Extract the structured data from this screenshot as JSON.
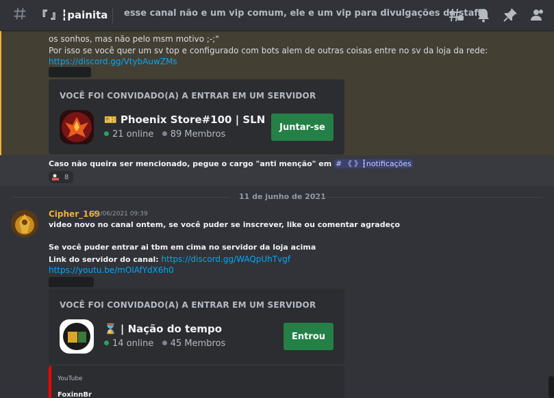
{
  "header": {
    "channel_name": "『 』┇painita",
    "topic": "esse canal não e um vip comum, ele e um vip para divulgações da staff",
    "icons": [
      "threads-icon",
      "bell-icon",
      "pin-icon",
      "members-icon"
    ]
  },
  "message1": {
    "line_partial": "os sonhos, mas não pelo msm motivo ;-;\"",
    "line2": "Por isso se você quer um sv top e configurado com bots alem de outras coisas entre no sv da loja da rede:",
    "link": "https://discord.gg/VtybAuwZMs",
    "invite": {
      "title": "VOCÊ FOI CONVIDADO(A) A ENTRAR EM UM SERVIDOR",
      "server_name": "🎫 Phoenix Store#100 | SLN",
      "online": "21 online",
      "members": "89 Membros",
      "button": "Juntar-se"
    },
    "mention_text": "Caso não queira ser mencionado, pegue o cargo \"anti menção\" em",
    "mention_channel": "# 《 》┇notificações",
    "reaction_count": "8"
  },
  "date_separator": "11 de junho de 2021",
  "message2": {
    "author": "Cipher_169",
    "timestamp": "11/06/2021 09:39",
    "line1": "video novo no canal ontem, se você puder se inscrever, like ou comentar agradeço",
    "line2": "Se você puder entrar ai tbm em cima no servidor da loja acima",
    "line3_label": "Link do servidor do canal:",
    "line3_link": "https://discord.gg/WAQpUhTvgf",
    "link2": "https://youtu.be/mOlAfYdX6h0",
    "invite": {
      "title": "VOCÊ FOI CONVIDADO(A) A ENTRAR EM UM SERVIDOR",
      "server_name": "⌛ | Nação do tempo",
      "online": "14 online",
      "members": "45 Membros",
      "button": "Entrou"
    },
    "embed": {
      "provider": "YouTube",
      "author": "FoxinnBr"
    }
  },
  "colors": {
    "online": "#23a55a",
    "offline": "#80848e",
    "link": "#00a8fc",
    "button": "#248046",
    "highlight_border": "#f0b232",
    "youtube": "#ff0000"
  }
}
